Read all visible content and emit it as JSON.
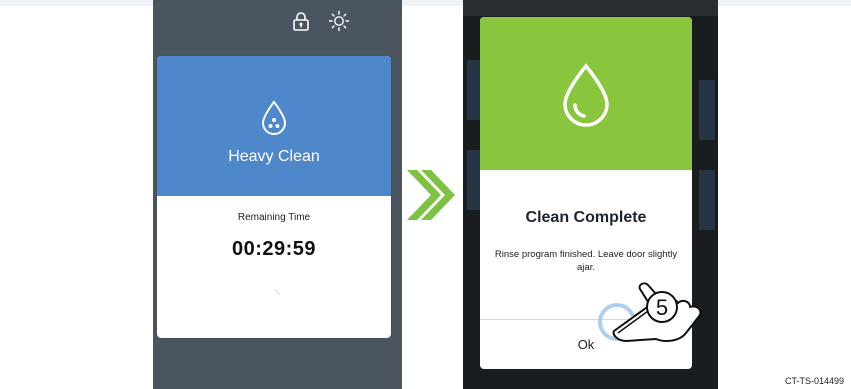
{
  "left_screen": {
    "icons": [
      "lock-icon",
      "brightness-icon"
    ],
    "program": {
      "icon": "water-drop-dots-icon",
      "name": "Heavy Clean"
    },
    "remaining": {
      "label": "Remaining Time",
      "value": "00:29:59"
    }
  },
  "transition_icon": "double-chevron-right-icon",
  "right_screen": {
    "dialog": {
      "icon": "water-drop-icon",
      "title": "Clean Complete",
      "message": "Rinse program finished. Leave door slightly ajar.",
      "ok_label": "Ok"
    },
    "step_number": "5"
  },
  "doc_code": "CT-TS-014499",
  "colors": {
    "program_blue": "#4f88ca",
    "complete_green": "#8ac53e",
    "arrow_green": "#7dc242",
    "panel_gray": "#4a5560"
  }
}
